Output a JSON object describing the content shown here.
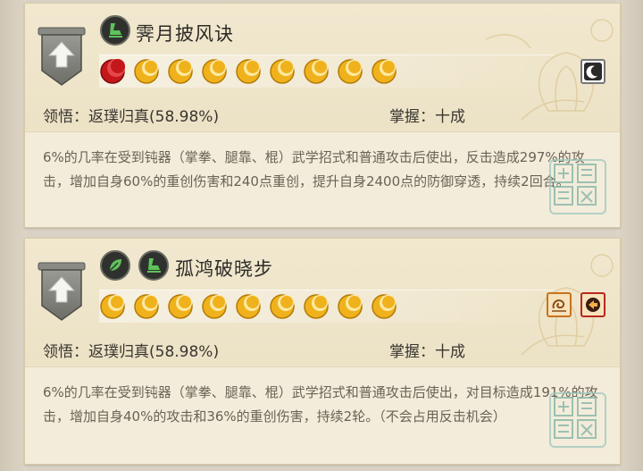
{
  "skills": [
    {
      "name": "霁月披风诀",
      "insight_label": "领悟：",
      "insight_value": "返璞归真(58.98%)",
      "mastery_label": "掌握：",
      "mastery_value": "十成",
      "description": "6%的几率在受到钝器（掌拳、腿靠、棍）武学招式和普通攻击后使出，反击造成297%的攻击，增加自身60%的重创伤害和240点重创，提升自身2400点的防御穿透，持续2回合。",
      "moons": [
        "red",
        "gold",
        "gold",
        "gold",
        "gold",
        "gold",
        "gold",
        "gold",
        "gold"
      ],
      "type_icons": [
        "leg-kick-icon"
      ],
      "side_icons": [
        "night-moon-icon"
      ]
    },
    {
      "name": "孤鸿破晓步",
      "insight_label": "领悟：",
      "insight_value": "返璞归真(58.98%)",
      "mastery_label": "掌握：",
      "mastery_value": "十成",
      "description": "6%的几率在受到钝器（掌拳、腿靠、棍）武学招式和普通攻击后使出，对目标造成191%的攻击，增加自身40%的攻击和36%的重创伤害，持续2轮。（不会占用反击机会）",
      "moons": [
        "gold",
        "gold",
        "gold",
        "gold",
        "gold",
        "gold",
        "gold",
        "gold",
        "gold"
      ],
      "type_icons": [
        "leaf-icon",
        "leg-kick-icon"
      ],
      "side_icons": [
        "swirl-icon",
        "counter-icon"
      ]
    }
  ],
  "colors": {
    "card_bg": "#efe6cd",
    "desc_bg": "#f3ecda",
    "moon_gold": "#f0b21c",
    "moon_red": "#c4171c",
    "icon_green": "#5fc25a"
  }
}
